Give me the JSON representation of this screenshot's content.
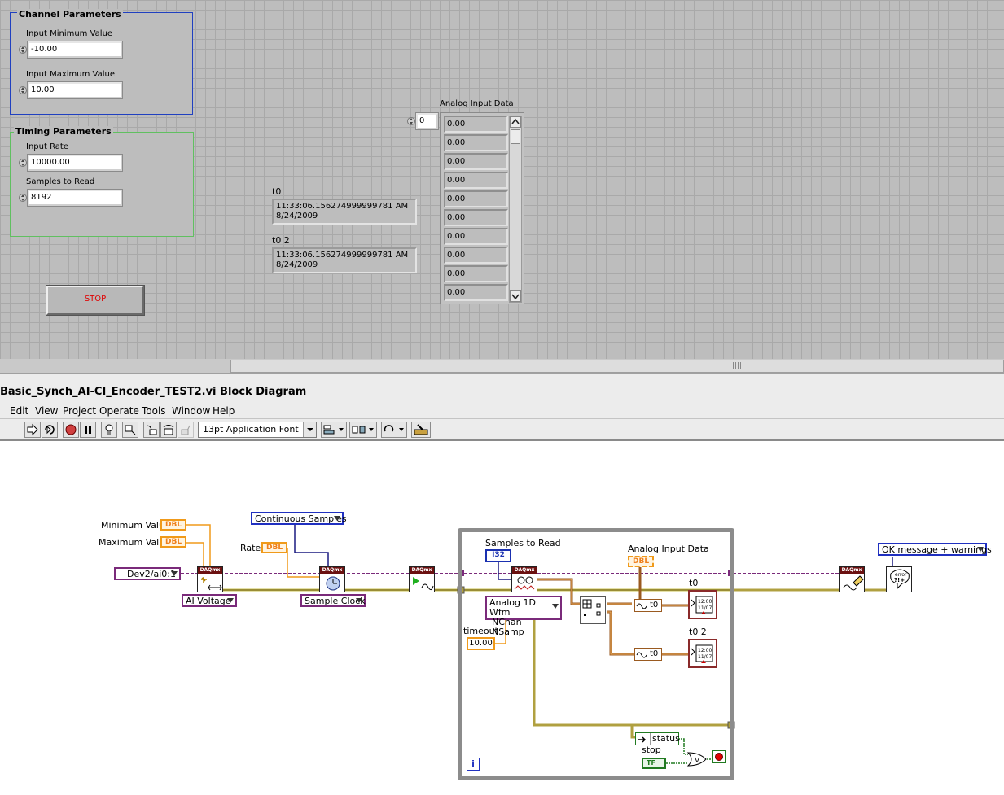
{
  "front_panel": {
    "channel_parameters": {
      "title": "Channel Parameters",
      "min_label": "Input Minimum Value",
      "min_value": "-10.00",
      "max_label": "Input Maximum Value",
      "max_value": "10.00"
    },
    "timing_parameters": {
      "title": "Timing Parameters",
      "rate_label": "Input Rate",
      "rate_value": "10000.00",
      "samples_label": "Samples to Read",
      "samples_value": "8192"
    },
    "stop_button": "STOP",
    "t0": {
      "label": "t0",
      "time": "11:33:06.156274999999781 AM",
      "date": "8/24/2009"
    },
    "t0_2": {
      "label": "t0 2",
      "time": "11:33:06.156274999999781 AM",
      "date": "8/24/2009"
    },
    "analog_input_data": {
      "label": "Analog Input Data",
      "index": "0",
      "values": [
        "0.00",
        "0.00",
        "0.00",
        "0.00",
        "0.00",
        "0.00",
        "0.00",
        "0.00",
        "0.00",
        "0.00"
      ]
    }
  },
  "window": {
    "title": "Basic_Synch_AI-CI_Encoder_TEST2.vi Block Diagram"
  },
  "menu": {
    "edit": "Edit",
    "view": "View",
    "project": "Project",
    "operate": "Operate",
    "tools": "Tools",
    "window": "Window",
    "help": "Help"
  },
  "toolbar": {
    "font": "13pt Application Font"
  },
  "block_diagram": {
    "min_value_label": "Minimum Value",
    "max_value_label": "Maximum Value",
    "rate_label": "Rate",
    "dbl": "DBL",
    "continuous_samples": "Continuous Samples",
    "channel": "Dev2/ai0:1",
    "ai_voltage": "AI Voltage",
    "sample_clock": "Sample Clock",
    "samples_to_read_label": "Samples to Read",
    "i32": "I32",
    "read_mode_line1": "Analog 1D Wfm",
    "read_mode_line2": "NChan NSamp",
    "timeout_label": "timeout",
    "timeout_value": "10.00",
    "analog_input_data_label": "Analog Input Data",
    "t0_label": "t0",
    "t0_2_label": "t0 2",
    "t0_unbundle": "t0",
    "t0_2_unbundle": "t0",
    "status": "status",
    "stop_label": "stop",
    "tf": "TF",
    "ok_message": "OK message + warnings",
    "daqmx": "DAQmx",
    "clock_face": "12:00",
    "clock_date": "11/07",
    "iteration": "i"
  }
}
